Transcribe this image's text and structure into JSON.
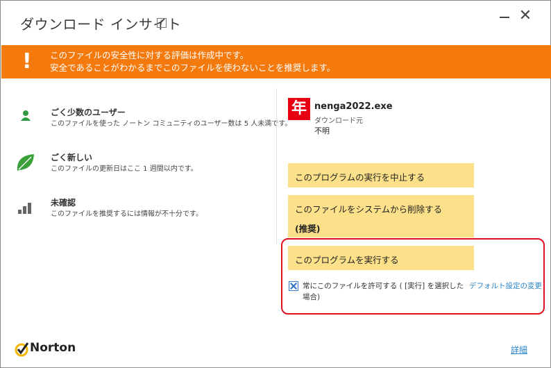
{
  "window": {
    "title": "ダウンロード インサイト",
    "help_icon": "question-mark-icon",
    "help_glyph": "?",
    "close_glyph": "✕"
  },
  "banner": {
    "icon_glyph": "!",
    "line1": "このファイルの安全性に対する評価は作成中です。",
    "line2": "安全であることがわかるまでこのファイルを使わないことを推奨します。",
    "color": "#f47a0e"
  },
  "factors": [
    {
      "icon": "user-icon",
      "heading": "ごく少数のユーザー",
      "description": "このファイルを使った ノートン コミュニティのユーザー数は 5 人未満です。"
    },
    {
      "icon": "leaf-icon",
      "heading": "ごく新しい",
      "description": "このファイルの更新日はここ 1 週間以内です。"
    },
    {
      "icon": "signal-bars-icon",
      "heading": "未確認",
      "description": "このファイルを推奨するには情報が不十分です。"
    }
  ],
  "file": {
    "icon_char": "年",
    "name": "nenga2022.exe",
    "source_label": "ダウンロード元",
    "source_value": "不明"
  },
  "actions": {
    "stop": "このプログラムの実行を中止する",
    "remove": "このファイルをシステムから削除する",
    "remove_note": "(推奨)",
    "run": "このプログラムを実行する",
    "color": "#fde08a"
  },
  "allow": {
    "checked": true,
    "label": "常にこのファイルを許可する ( [実行] を選択した場合)",
    "default_link": "デフォルト設定の変更"
  },
  "footer": {
    "logo": "Norton",
    "details_link": "詳細"
  }
}
